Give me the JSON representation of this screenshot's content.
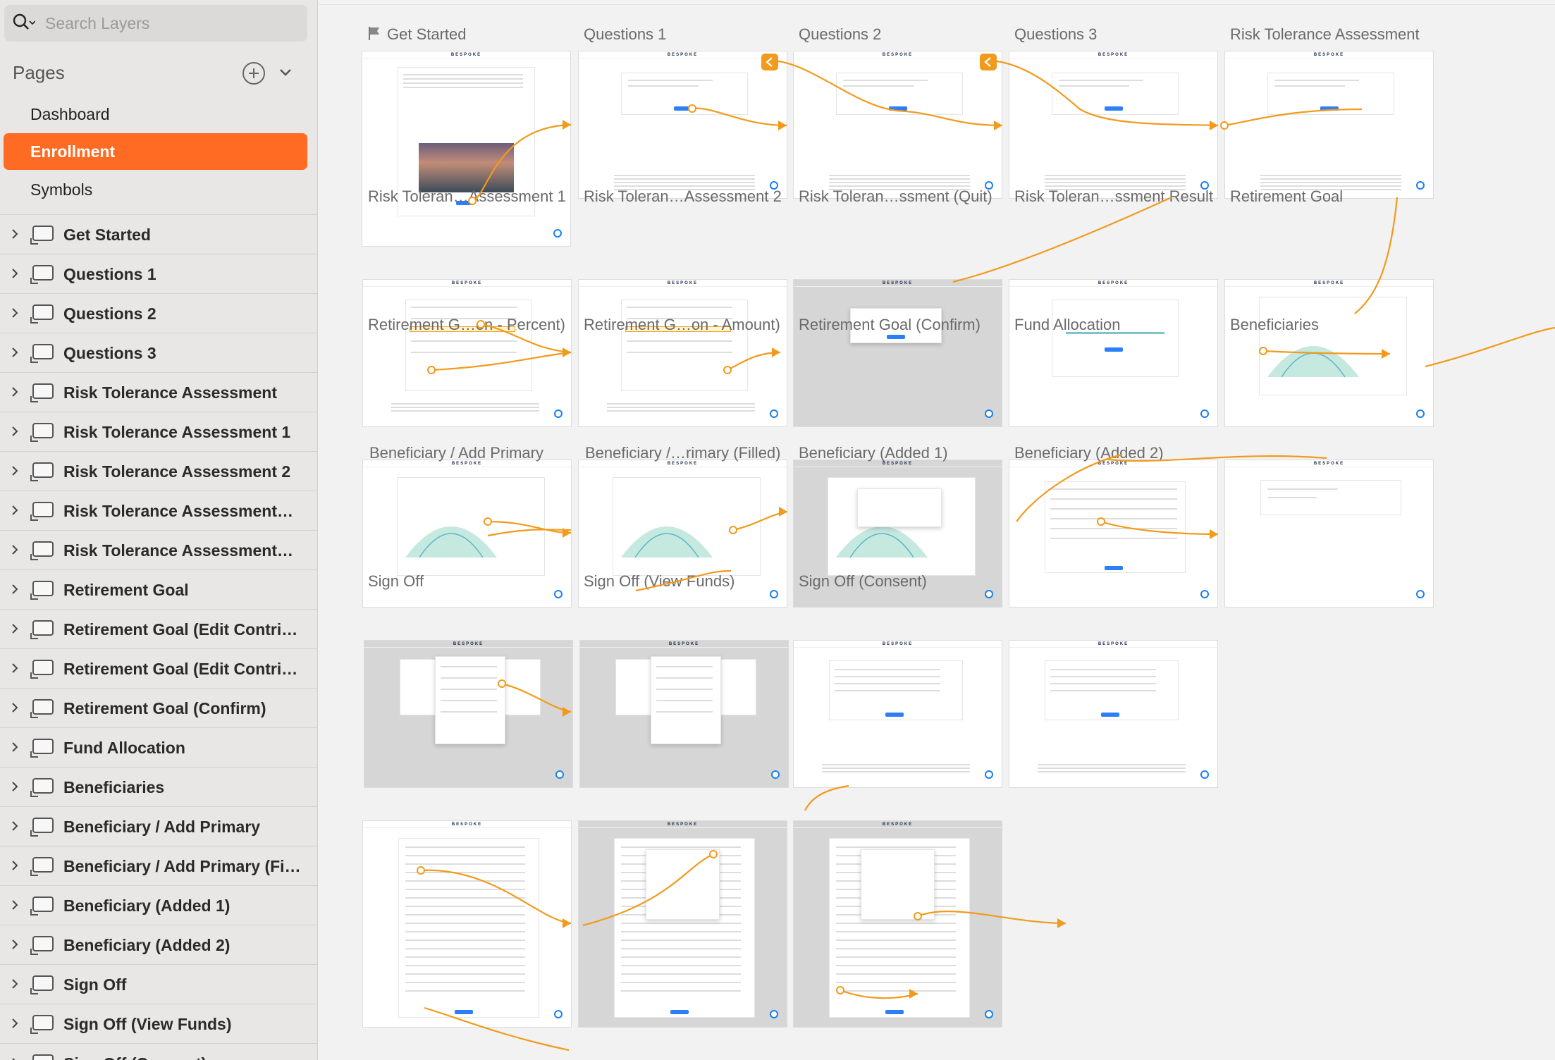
{
  "search": {
    "placeholder": "Search Layers"
  },
  "pages": {
    "title": "Pages",
    "items": [
      {
        "label": "Dashboard",
        "active": false
      },
      {
        "label": "Enrollment",
        "active": true
      },
      {
        "label": "Symbols",
        "active": false
      }
    ]
  },
  "layers": [
    "Get Started",
    "Questions 1",
    "Questions 2",
    "Questions 3",
    "Risk Tolerance Assessment",
    "Risk Tolerance Assessment 1",
    "Risk Tolerance Assessment 2",
    "Risk Tolerance Assessment…",
    "Risk Tolerance Assessment…",
    "Retirement Goal",
    "Retirement Goal (Edit Contri…",
    "Retirement Goal (Edit Contri…",
    "Retirement Goal (Confirm)",
    "Fund Allocation",
    "Beneficiaries",
    "Beneficiary / Add Primary",
    "Beneficiary / Add Primary (Fi…",
    "Beneficiary (Added 1)",
    "Beneficiary (Added 2)",
    "Sign Off",
    "Sign Off (View Funds)",
    "Sign Off (Consent)"
  ],
  "artboards": [
    {
      "title": "Get Started",
      "kind": "intro",
      "dim": false,
      "flag": true
    },
    {
      "title": "Questions 1",
      "kind": "question",
      "dim": false
    },
    {
      "title": "Questions 2",
      "kind": "question",
      "dim": false
    },
    {
      "title": "Questions 3",
      "kind": "question",
      "dim": false
    },
    {
      "title": "Risk Tolerance Assessment",
      "kind": "question",
      "dim": false
    },
    {
      "title": "Risk Toleran…Assessment 1",
      "kind": "list",
      "dim": false
    },
    {
      "title": "Risk Toleran…Assessment 2",
      "kind": "list",
      "dim": false
    },
    {
      "title": "Risk Toleran…ssment (Quit)",
      "kind": "modal",
      "dim": true
    },
    {
      "title": "Risk Toleran…ssment Result",
      "kind": "result",
      "dim": false
    },
    {
      "title": "Retirement Goal",
      "kind": "chart",
      "dim": false
    },
    {
      "title": "Retirement G…on - Percent)",
      "kind": "chart",
      "dim": false
    },
    {
      "title": "Retirement G…on - Amount)",
      "kind": "chart",
      "dim": false
    },
    {
      "title": "Retirement Goal (Confirm)",
      "kind": "chartmodal",
      "dim": true
    },
    {
      "title": "Fund Allocation",
      "kind": "form",
      "dim": false
    },
    {
      "title": "Beneficiaries",
      "kind": "small",
      "dim": false
    },
    {
      "title": "Beneficiary / Add Primary",
      "kind": "formmodal",
      "dim": true
    },
    {
      "title": "Beneficiary /…rimary (Filled)",
      "kind": "formmodal",
      "dim": true
    },
    {
      "title": "Beneficiary (Added 1)",
      "kind": "table",
      "dim": false
    },
    {
      "title": "Beneficiary (Added 2)",
      "kind": "table",
      "dim": false
    },
    {
      "title": "Sign Off",
      "kind": "doc",
      "dim": false
    },
    {
      "title": "Sign Off (View Funds)",
      "kind": "docmodal",
      "dim": true
    },
    {
      "title": "Sign Off (Consent)",
      "kind": "docmodal",
      "dim": true
    }
  ],
  "artboard_logo": "BESPOKE",
  "colors": {
    "accent": "#ff6b22",
    "flow": "#f29a1b",
    "selection": "#1a7ff0"
  }
}
